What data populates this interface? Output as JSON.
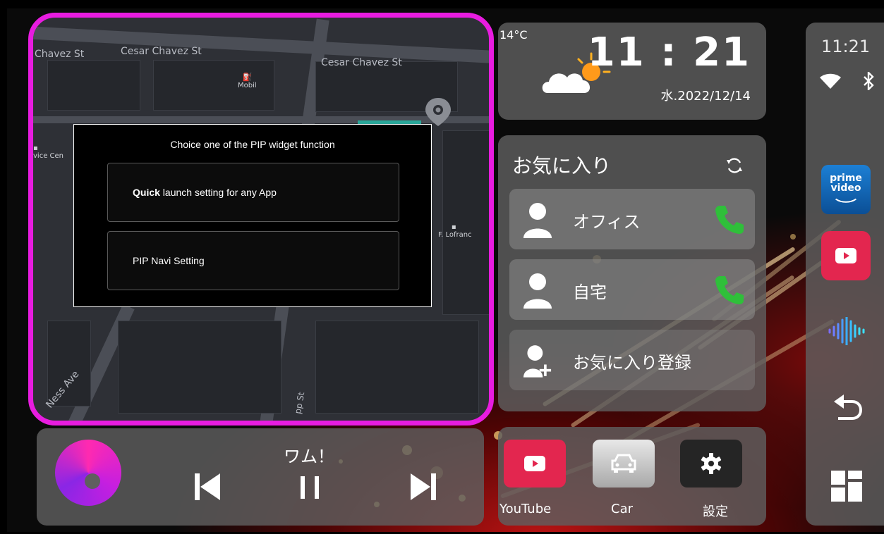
{
  "map": {
    "street_top_left": "Chavez St",
    "street_top_mid": "Cesar Chavez St",
    "street_top_right": "Cesar Chavez St",
    "poi_mobil": "Mobil",
    "poi_left": "vice Cen",
    "poi_right": "F. Lofranc",
    "street_ness": "Ness Ave",
    "street_pp": "pp St"
  },
  "dialog": {
    "title": "Choice one of the PIP widget function",
    "options": [
      {
        "bold": "Quick",
        "rest": " launch setting for any App"
      },
      {
        "bold": "",
        "rest": "PIP Navi Setting"
      }
    ]
  },
  "clock": {
    "temperature": "14°C",
    "time": "11 : 21",
    "date": "水.2022/12/14"
  },
  "favorites": {
    "title": "お気に入り",
    "items": [
      {
        "label": "オフィス"
      },
      {
        "label": "自宅"
      },
      {
        "label": "お気に入り登録"
      }
    ]
  },
  "music": {
    "song": "ワム！"
  },
  "apps": [
    {
      "label": "YouTube",
      "color": "#e3264f"
    },
    {
      "label": "Car",
      "color": "#c8c8c8"
    },
    {
      "label": "設定",
      "color": "#2a2a2a"
    }
  ],
  "side": {
    "time": "11:21",
    "prime_label_1": "prime",
    "prime_label_2": "video"
  }
}
